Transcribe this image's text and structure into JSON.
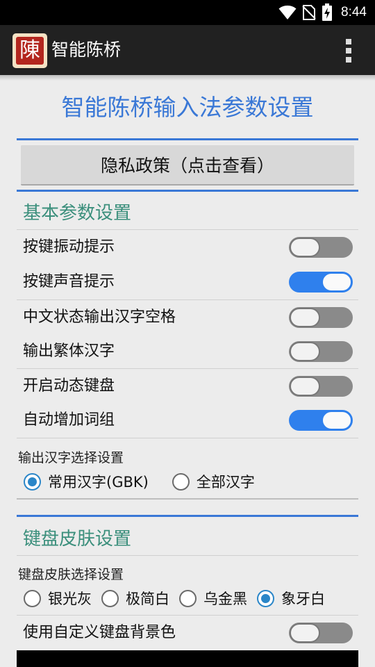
{
  "status_bar": {
    "time": "8:44",
    "icons": [
      "wifi-icon",
      "no-sim-icon",
      "battery-charging-icon"
    ]
  },
  "app_bar": {
    "logo_char": "陳",
    "title": "智能陈桥",
    "menu_icon": "overflow-menu-icon"
  },
  "page_title": "智能陈桥输入法参数设置",
  "privacy_button": "隐私政策（点击查看）",
  "basic_section": {
    "title": "基本参数设置",
    "settings": [
      {
        "label": "按键振动提示",
        "on": false
      },
      {
        "label": "按键声音提示",
        "on": true
      },
      {
        "label": "中文状态输出汉字空格",
        "on": false
      },
      {
        "label": "输出繁体汉字",
        "on": false
      },
      {
        "label": "开启动态键盘",
        "on": false
      },
      {
        "label": "自动增加词组",
        "on": true
      }
    ],
    "charset_group": {
      "label": "输出汉字选择设置",
      "options": [
        {
          "label": "常用汉字(GBK)",
          "checked": true
        },
        {
          "label": "全部汉字",
          "checked": false
        }
      ]
    }
  },
  "skin_section": {
    "title": "键盘皮肤设置",
    "skin_group": {
      "label": "键盘皮肤选择设置",
      "options": [
        {
          "label": "银光灰",
          "checked": false
        },
        {
          "label": "极简白",
          "checked": false
        },
        {
          "label": "乌金黑",
          "checked": false
        },
        {
          "label": "象牙白",
          "checked": true
        }
      ]
    },
    "custom_bg": {
      "label": "使用自定义键盘背景色",
      "on": false
    }
  },
  "colors": {
    "accent": "#3a78d6",
    "section_title": "#3b8f7c",
    "switch_on": "#2f80ed",
    "switch_off": "#8a8a8a"
  }
}
